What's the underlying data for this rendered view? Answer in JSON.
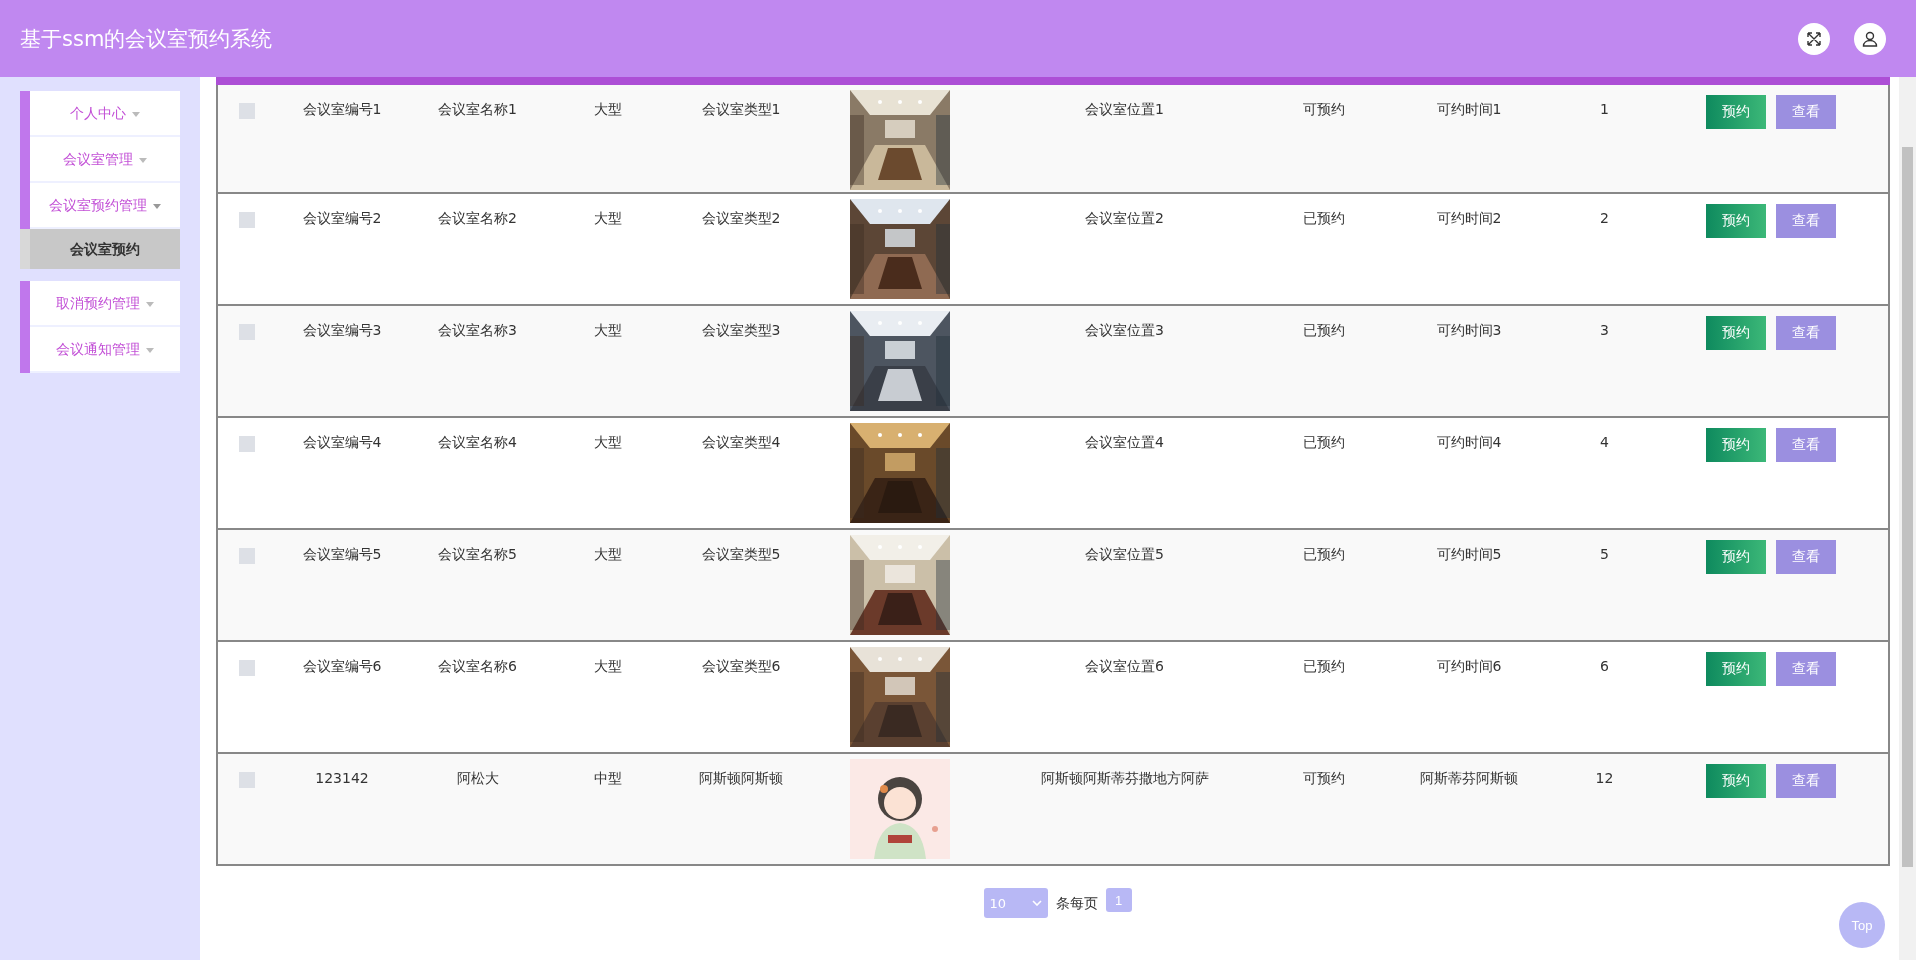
{
  "header": {
    "title": "基于ssm的会议室预约系统"
  },
  "sidebar": {
    "groups": [
      {
        "items": [
          {
            "label": "个人中心",
            "expanded": false
          },
          {
            "label": "会议室管理",
            "expanded": false
          },
          {
            "label": "会议室预约管理",
            "expanded": true,
            "children": [
              {
                "label": "会议室预约",
                "selected": true
              }
            ]
          }
        ]
      },
      {
        "items": [
          {
            "label": "取消预约管理",
            "expanded": false
          },
          {
            "label": "会议通知管理",
            "expanded": false
          }
        ]
      }
    ]
  },
  "table": {
    "rows": [
      {
        "checked": false,
        "number": "会议室编号1",
        "name": "会议室名称1",
        "size": "大型",
        "type": "会议室类型1",
        "photo": {
          "kind": "picture"
        },
        "location": "会议室位置1",
        "status": "可预约",
        "time": "可约时间1",
        "count": "1",
        "actions": [
          "预约",
          "查看"
        ]
      },
      {
        "checked": false,
        "number": "会议室编号2",
        "name": "会议室名称2",
        "size": "大型",
        "type": "会议室类型2",
        "photo": {
          "kind": "picture"
        },
        "location": "会议室位置2",
        "status": "已预约",
        "time": "可约时间2",
        "count": "2",
        "actions": [
          "预约",
          "查看"
        ]
      },
      {
        "checked": false,
        "number": "会议室编号3",
        "name": "会议室名称3",
        "size": "大型",
        "type": "会议室类型3",
        "photo": {
          "kind": "picture"
        },
        "location": "会议室位置3",
        "status": "已预约",
        "time": "可约时间3",
        "count": "3",
        "actions": [
          "预约",
          "查看"
        ]
      },
      {
        "checked": false,
        "number": "会议室编号4",
        "name": "会议室名称4",
        "size": "大型",
        "type": "会议室类型4",
        "photo": {
          "kind": "picture"
        },
        "location": "会议室位置4",
        "status": "已预约",
        "time": "可约时间4",
        "count": "4",
        "actions": [
          "预约",
          "查看"
        ]
      },
      {
        "checked": false,
        "number": "会议室编号5",
        "name": "会议室名称5",
        "size": "大型",
        "type": "会议室类型5",
        "photo": {
          "kind": "picture"
        },
        "location": "会议室位置5",
        "status": "已预约",
        "time": "可约时间5",
        "count": "5",
        "actions": [
          "预约",
          "查看"
        ]
      },
      {
        "checked": false,
        "number": "会议室编号6",
        "name": "会议室名称6",
        "size": "大型",
        "type": "会议室类型6",
        "photo": {
          "kind": "picture"
        },
        "location": "会议室位置6",
        "status": "已预约",
        "time": "可约时间6",
        "count": "6",
        "actions": [
          "预约",
          "查看"
        ]
      },
      {
        "checked": false,
        "number": "123142",
        "name": "阿松大",
        "size": "中型",
        "type": "阿斯顿阿斯顿",
        "photo": {
          "kind": "picture"
        },
        "location": "阿斯顿阿斯蒂芬撒地方阿萨",
        "status": "可预约",
        "time": "阿斯蒂芬阿斯顿",
        "count": "12",
        "actions": [
          "预约",
          "查看"
        ]
      }
    ]
  },
  "pagination": {
    "page_size": "10",
    "page_size_label": "条每页",
    "pages": [
      {
        "label": "1",
        "selected": true
      }
    ]
  },
  "back_to_top": "Top"
}
